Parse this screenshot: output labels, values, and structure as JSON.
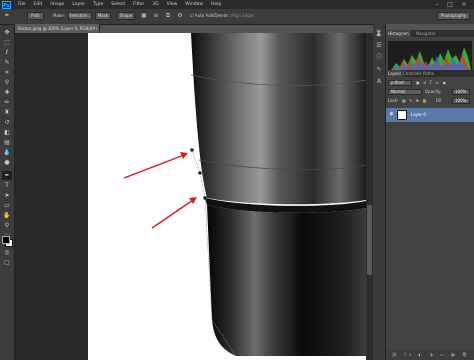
{
  "app": {
    "logo": "Ps"
  },
  "menu": {
    "items": [
      "File",
      "Edit",
      "Image",
      "Layer",
      "Type",
      "Select",
      "Filter",
      "3D",
      "View",
      "Window",
      "Help"
    ]
  },
  "window_controls": {
    "minimize": "–",
    "maximize": "□",
    "close": "×"
  },
  "options": {
    "mode": "Path",
    "make_label": "Make:",
    "selection": "Selection...",
    "mask": "Mask",
    "shape": "Shape",
    "auto_add": "Auto Add/Delete",
    "align_edges": "Align Edges",
    "workspace": "Photography"
  },
  "document": {
    "tab_title": "Button.jpeg @ 300% (Layer 0, RGB/8#) *"
  },
  "panels": {
    "histogram_tabs": [
      "Histogram",
      "Navigator"
    ],
    "layers_tabs": [
      "Layers",
      "Channels",
      "Paths"
    ],
    "kind": "ρ Kind",
    "blend_mode": "Normal",
    "opacity_label": "Opacity:",
    "opacity_value": "100%",
    "lock_label": "Lock:",
    "fill_label": "Fill:",
    "fill_value": "100%",
    "layer_name": "Layer 0"
  },
  "colors": {
    "annotation_arrow": "#d42020",
    "selected_layer": "#5a79a8"
  }
}
